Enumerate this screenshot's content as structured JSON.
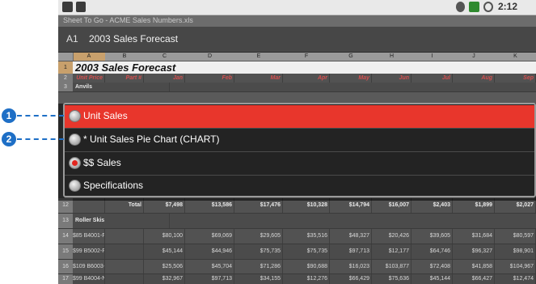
{
  "status_bar": {
    "time": "2:12"
  },
  "app": {
    "title": "Sheet To Go - ACME Sales Numbers.xls"
  },
  "formula_bar": {
    "cell_ref": "A1",
    "cell_value": "2003 Sales Forecast"
  },
  "sheet": {
    "columns": [
      "A",
      "B",
      "C",
      "D",
      "E",
      "F",
      "G",
      "H",
      "I",
      "J",
      "K"
    ],
    "active_column": "A",
    "rows": [
      {
        "num": "1",
        "cells": [
          "2003 Sales Forecast"
        ]
      },
      {
        "num": "2",
        "cells": [
          "Unit Price",
          "Part #",
          "Jan",
          "Feb",
          "Mar",
          "Apr",
          "May",
          "Jun",
          "Jul",
          "Aug",
          "Sep"
        ]
      },
      {
        "num": "3",
        "cells": [
          "Anvils"
        ]
      },
      {
        "num": "12",
        "cells": [
          "",
          "Total",
          "$7,498",
          "$13,586",
          "$17,476",
          "$10,328",
          "$14,794",
          "$16,007",
          "$2,403",
          "$1,899",
          "$2,027"
        ]
      },
      {
        "num": "13",
        "cells": [
          "Roller Skis"
        ]
      },
      {
        "num": "14",
        "cells": [
          "$85 B4001-F",
          "",
          "$80,100",
          "$69,069",
          "$29,605",
          "$35,516",
          "$48,327",
          "$20,426",
          "$39,605",
          "$31,684",
          "$80,597"
        ]
      },
      {
        "num": "15",
        "cells": [
          "$99 B5002-F",
          "",
          "$45,144",
          "$44,946",
          "$75,735",
          "$75,735",
          "$97,713",
          "$12,177",
          "$64,746",
          "$96,327",
          "$98,901"
        ]
      },
      {
        "num": "16",
        "cells": [
          "$109 B6003-F",
          "",
          "$25,506",
          "$45,704",
          "$71,286",
          "$90,688",
          "$16,023",
          "$103,877",
          "$72,408",
          "$41,858",
          "$104,967"
        ]
      },
      {
        "num": "17",
        "cells": [
          "$99 B4004-NF",
          "",
          "$32,967",
          "$97,713",
          "$34,155",
          "$12,276",
          "$66,429",
          "$75,636",
          "$45,144",
          "$66,427",
          "$12,474"
        ]
      }
    ]
  },
  "dialog": {
    "options": [
      {
        "label": "Unit Sales",
        "selected": true,
        "checked": false
      },
      {
        "label": "* Unit Sales Pie Chart (CHART)",
        "selected": false,
        "checked": false
      },
      {
        "label": "$$ Sales",
        "selected": false,
        "checked": true
      },
      {
        "label": "Specifications",
        "selected": false,
        "checked": false
      }
    ]
  },
  "callouts": [
    "1",
    "2"
  ],
  "colors": {
    "selected_option": "#e8362c",
    "callout": "#1e6fc6",
    "radio_checked": "#e3261f"
  }
}
